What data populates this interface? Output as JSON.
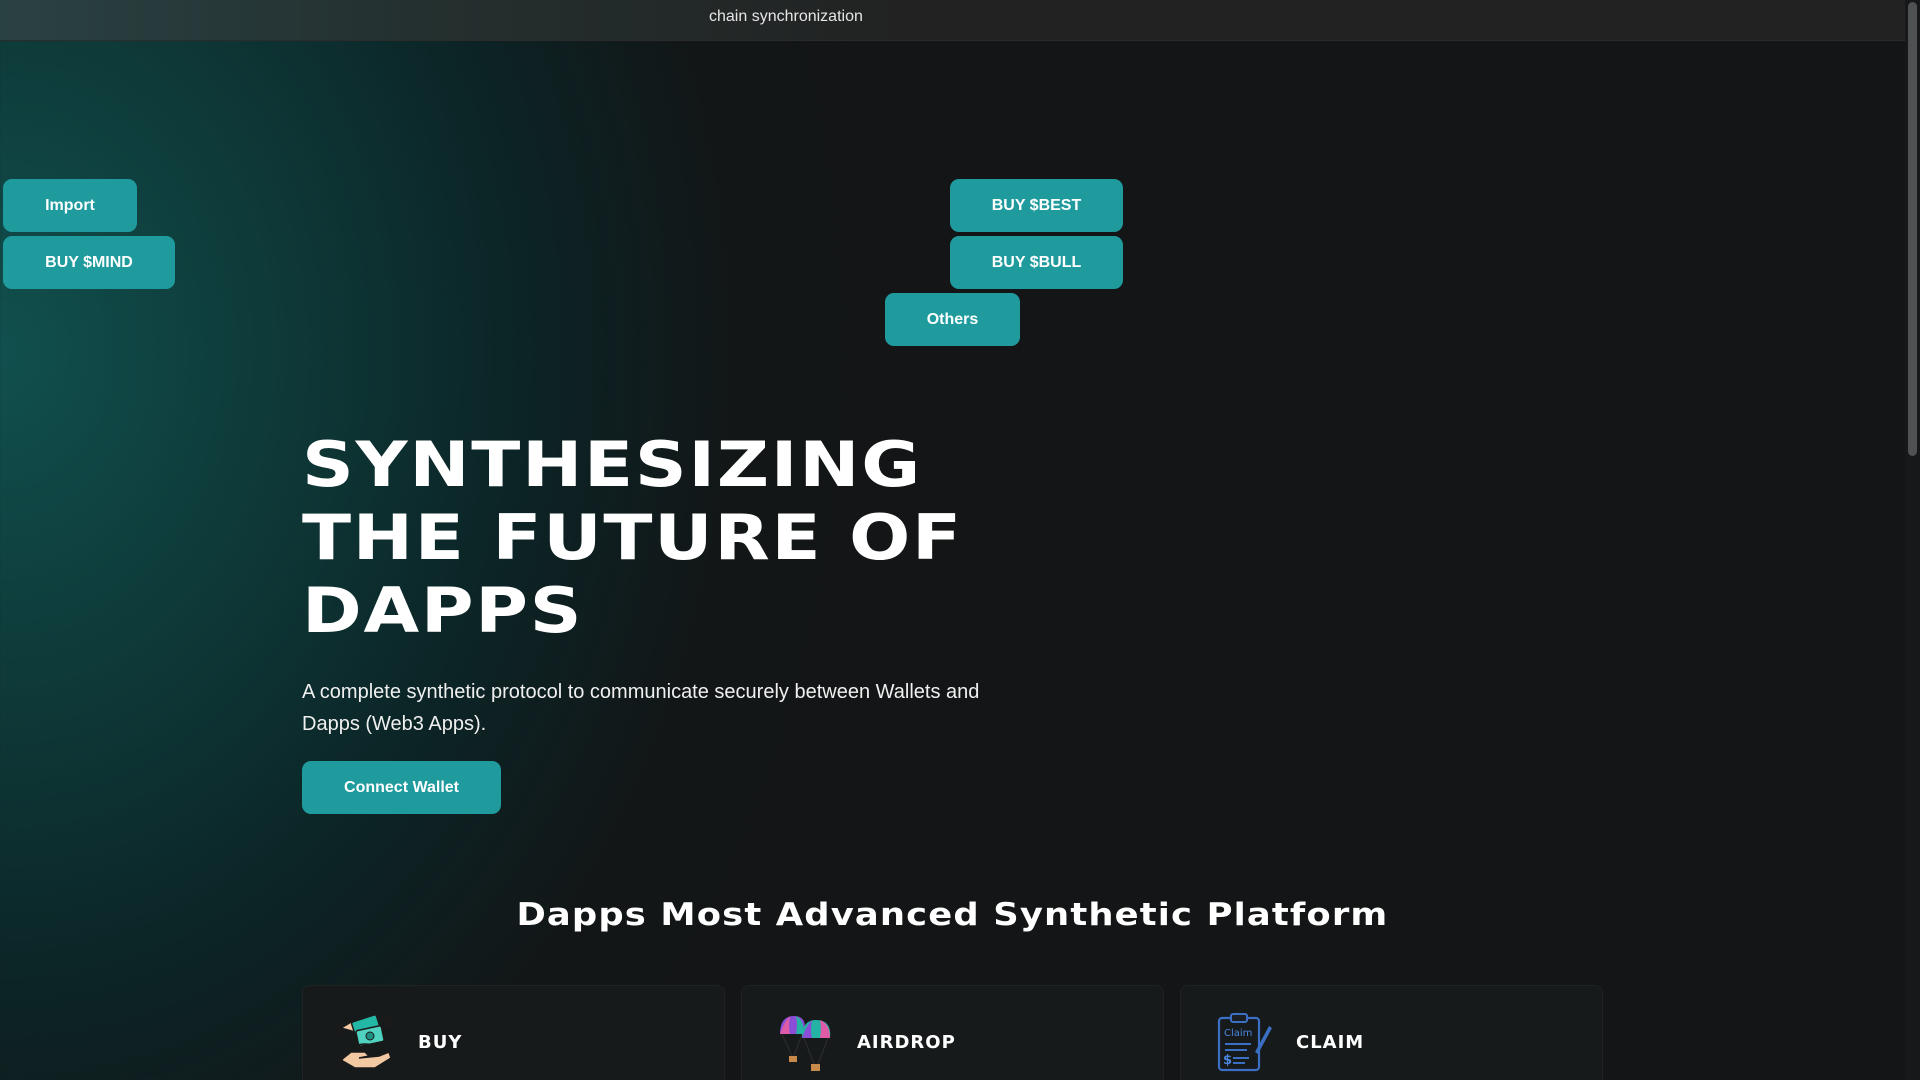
{
  "topbar": {
    "text": "chain synchronization"
  },
  "buttons": {
    "import": "Import",
    "buy_mind": "BUY $MIND",
    "buy_best": "BUY $BEST",
    "buy_bull": "BUY $BULL",
    "others": "Others"
  },
  "hero": {
    "title_line1": "SYNTHESIZING",
    "title_line2": "THE FUTURE OF",
    "title_line3": "DAPPS",
    "subtitle": "A complete synthetic protocol to communicate securely between Wallets and Dapps (Web3 Apps).",
    "connect_label": "Connect Wallet"
  },
  "section": {
    "title": "Dapps Most Advanced Synthetic Platform"
  },
  "cards": [
    {
      "label": "BUY",
      "icon": "hand-money-icon"
    },
    {
      "label": "AIRDROP",
      "icon": "parachute-icon"
    },
    {
      "label": "CLAIM",
      "icon": "clipboard-claim-icon"
    }
  ],
  "claim_icon_text": "Claim",
  "colors": {
    "accent": "#1f9b9e",
    "background": "#131516",
    "card": "#171a1b"
  }
}
